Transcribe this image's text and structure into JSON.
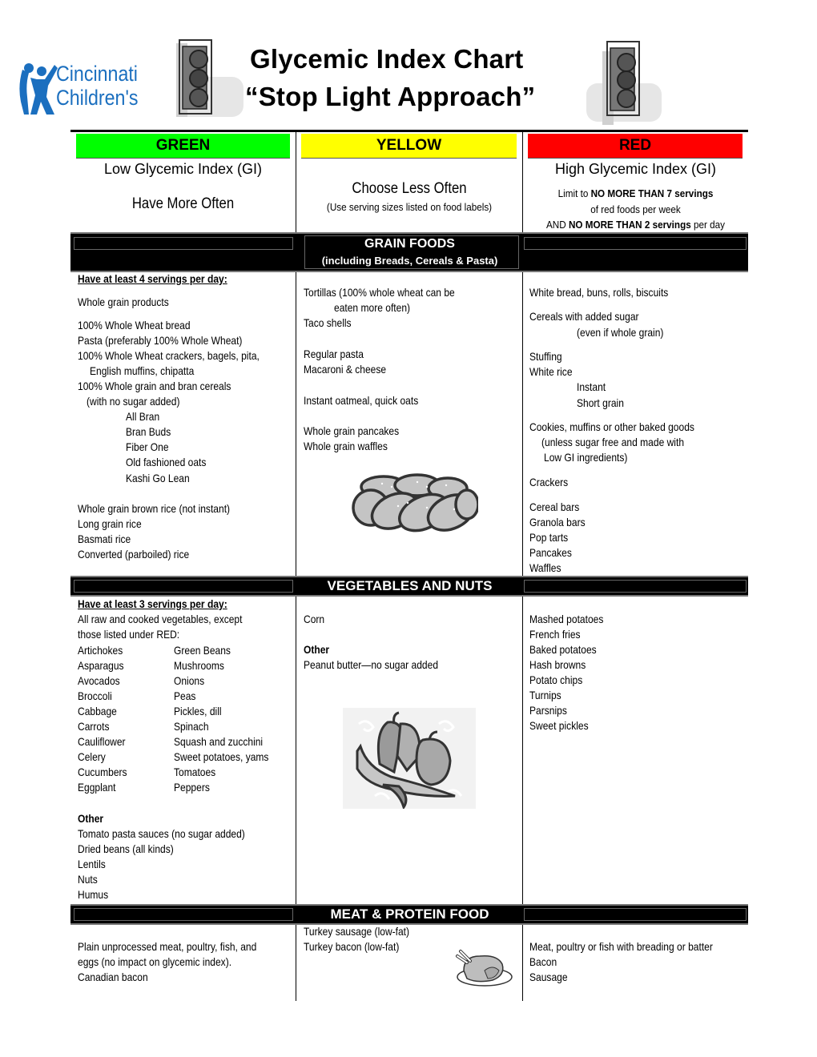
{
  "header": {
    "logo": {
      "line1": "Cincinnati",
      "line2": "Children's"
    },
    "title_line1": "Glycemic Index Chart",
    "title_line2": "“Stop Light Approach”"
  },
  "columns": {
    "green": {
      "label": "GREEN",
      "color": "#00ff00",
      "subtitle": "Low Glycemic Index (GI)",
      "advice": "Have More Often"
    },
    "yellow": {
      "label": "YELLOW",
      "color": "#ffff00",
      "advice": "Choose Less Often",
      "note": "(Use serving sizes listed on food labels)"
    },
    "red": {
      "label": "RED",
      "color": "#ff0000",
      "subtitle": "High Glycemic Index (GI)",
      "limit_prefix": "Limit to ",
      "limit_bold": "NO MORE THAN 7 servings",
      "limit_line2": "of red foods per week",
      "limit_line3_prefix": "AND ",
      "limit_line3_bold": "NO MORE THAN 2 servings",
      "limit_line3_suffix": " per day"
    }
  },
  "sections": {
    "grain": {
      "title": "GRAIN FOODS",
      "subtitle": "(including Breads, Cereals & Pasta)",
      "green_heading": "Have at least 4 servings per day:",
      "green": [
        "Whole grain products",
        "100% Whole Wheat bread",
        "Pasta (preferably 100% Whole Wheat)",
        "100% Whole Wheat crackers, bagels, pita,",
        "English muffins, chipatta",
        "100% Whole grain and bran cereals",
        "(with no sugar added)",
        "All Bran",
        "Bran Buds",
        "Fiber One",
        "Old fashioned oats",
        "Kashi Go Lean",
        "Whole grain brown rice (not instant)",
        "Long grain rice",
        "Basmati rice",
        "Converted (parboiled) rice"
      ],
      "yellow": [
        "Tortillas (100% whole wheat can be",
        "eaten more often)",
        "Taco shells",
        "Regular pasta",
        "Macaroni & cheese",
        "Instant oatmeal, quick oats",
        "Whole grain pancakes",
        "Whole grain waffles"
      ],
      "red": [
        "White bread, buns, rolls, biscuits",
        "Cereals with added sugar",
        "(even if whole grain)",
        "Stuffing",
        "White rice",
        "Instant",
        "Short grain",
        "Cookies, muffins or other baked goods",
        "(unless sugar free and made with",
        "Low GI ingredients)",
        "Crackers",
        "Cereal bars",
        "Granola bars",
        "Pop tarts",
        "Pancakes",
        "Waffles"
      ]
    },
    "vegetables": {
      "title": "VEGETABLES AND NUTS",
      "green_heading": "Have at least 3 servings per day:",
      "green_intro": [
        "All raw and cooked vegetables, except",
        "those listed under RED:"
      ],
      "green_col1": [
        "Artichokes",
        "Asparagus",
        "Avocados",
        "Broccoli",
        "Cabbage",
        "Carrots",
        "Cauliflower",
        "Celery",
        "Cucumbers",
        "Eggplant"
      ],
      "green_col2": [
        "Green Beans",
        "Mushrooms",
        "Onions",
        "Peas",
        "Pickles, dill",
        "Spinach",
        "Squash and zucchini",
        "Sweet potatoes, yams",
        "Tomatoes",
        "Peppers"
      ],
      "green_other_heading": "Other",
      "green_other": [
        "Tomato pasta sauces (no sugar added)",
        "Dried beans (all kinds)",
        "Lentils",
        "Nuts",
        "Humus"
      ],
      "yellow": [
        "Corn"
      ],
      "yellow_other_heading": "Other",
      "yellow_other": [
        "Peanut butter—no sugar added"
      ],
      "red": [
        "Mashed potatoes",
        "French fries",
        "Baked potatoes",
        "Hash browns",
        "Potato chips",
        "Turnips",
        "Parsnips",
        "Sweet pickles"
      ]
    },
    "meat": {
      "title": "MEAT & PROTEIN FOOD",
      "green": [
        "Plain unprocessed meat, poultry, fish, and",
        "eggs (no impact on glycemic index).",
        "Canadian bacon"
      ],
      "yellow": [
        "Turkey sausage (low-fat)",
        "Turkey bacon (low-fat)"
      ],
      "red": [
        "Meat, poultry or fish with breading or batter",
        "Bacon",
        "Sausage"
      ]
    }
  },
  "icons": {
    "logo": "cincinnati-childrens-logo",
    "traffic_light_left": "traffic-light-icon",
    "traffic_light_right": "traffic-light-icon",
    "bread": "braided-bread-icon",
    "peppers": "peppers-icon",
    "turkey": "roast-turkey-icon"
  }
}
